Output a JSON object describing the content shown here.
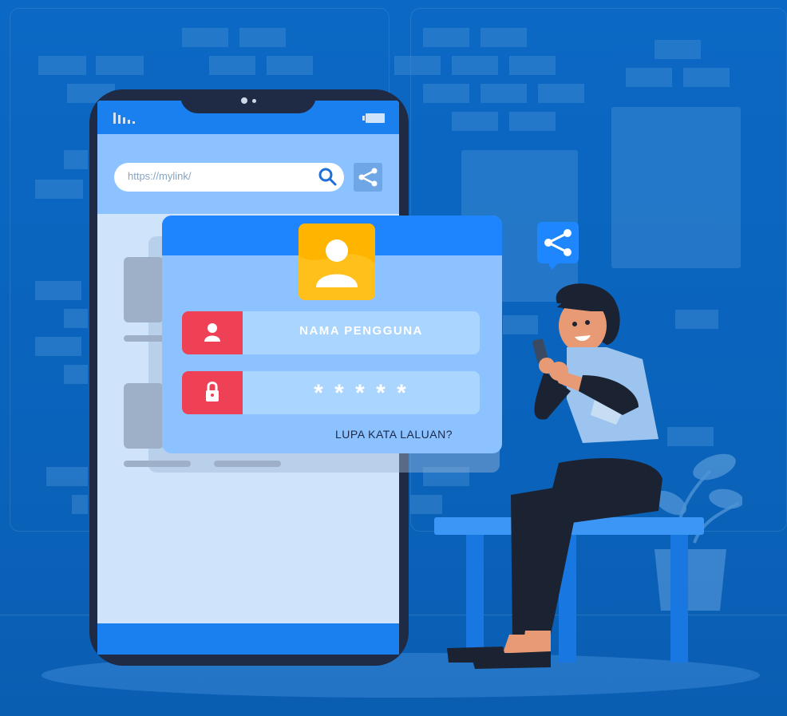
{
  "browser": {
    "url": "https://mylink/"
  },
  "login": {
    "username_label": "NAMA PENGGUNA",
    "password_mask": "* * * * *",
    "forgot_link": "LUPA KATA LALUAN?"
  },
  "icons": {
    "search": "search-icon",
    "share": "share-icon",
    "user": "user-icon",
    "lock": "lock-icon",
    "avatar": "avatar-icon"
  },
  "colors": {
    "background": "#0b68c4",
    "card": "#8cc2ff",
    "card_header": "#1f85ff",
    "avatar_bg": "#ffb400",
    "field_icon": "#ef4156",
    "field_bg": "#a9d5ff"
  }
}
